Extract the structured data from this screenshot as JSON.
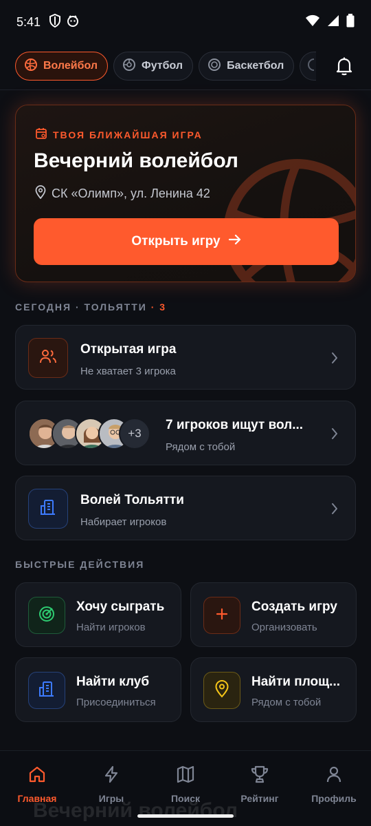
{
  "status_bar": {
    "time": "5:41"
  },
  "sport_tabs": [
    {
      "label": "Волейбол",
      "active": true,
      "icon": "volleyball-icon"
    },
    {
      "label": "Футбол",
      "active": false,
      "icon": "football-icon"
    },
    {
      "label": "Баскетбол",
      "active": false,
      "icon": "basketball-icon"
    }
  ],
  "hero": {
    "kicker": "ТВОЯ БЛИЖАЙШАЯ ИГРА",
    "title": "Вечерний волейбол",
    "place": "СК «Олимп», ул. Ленина 42",
    "button_label": "Открыть игру"
  },
  "today": {
    "label": "СЕГОДНЯ · ТОЛЬЯТТИ",
    "count": "· 3",
    "items": [
      {
        "title": "Открытая игра",
        "subtitle": "Не хватает 3 игрока",
        "icon": "users-icon"
      },
      {
        "title": "7 игроков ищут вол...",
        "subtitle": "Рядом с тобой",
        "avatars_more": "+3"
      },
      {
        "title": "Волей Тольятти",
        "subtitle": "Набирает игроков",
        "icon": "building-icon"
      }
    ]
  },
  "quick_actions": {
    "label": "БЫСТРЫЕ ДЕЙСТВИЯ",
    "items": [
      {
        "title": "Хочу сыграть",
        "subtitle": "Найти игроков",
        "icon": "radar-icon",
        "color": "#2ecc71"
      },
      {
        "title": "Создать игру",
        "subtitle": "Организовать",
        "icon": "plus-icon",
        "color": "#ff5a2d"
      },
      {
        "title": "Найти клуб",
        "subtitle": "Присоединиться",
        "icon": "building-icon",
        "color": "#3d7bff"
      },
      {
        "title": "Найти площ...",
        "subtitle": "Рядом с тобой",
        "icon": "location-pin-icon",
        "color": "#f5c518"
      }
    ]
  },
  "bottom_nav": {
    "ghost_text": "Вечерний волейбол",
    "items": [
      {
        "label": "Главная",
        "active": true,
        "icon": "home-icon"
      },
      {
        "label": "Игры",
        "active": false,
        "icon": "lightning-icon"
      },
      {
        "label": "Поиск",
        "active": false,
        "icon": "map-icon"
      },
      {
        "label": "Рейтинг",
        "active": false,
        "icon": "trophy-icon"
      },
      {
        "label": "Профиль",
        "active": false,
        "icon": "person-icon"
      }
    ]
  },
  "colors": {
    "accent": "#ff5a2d",
    "background": "#0d0f14",
    "card": "#15181f"
  }
}
